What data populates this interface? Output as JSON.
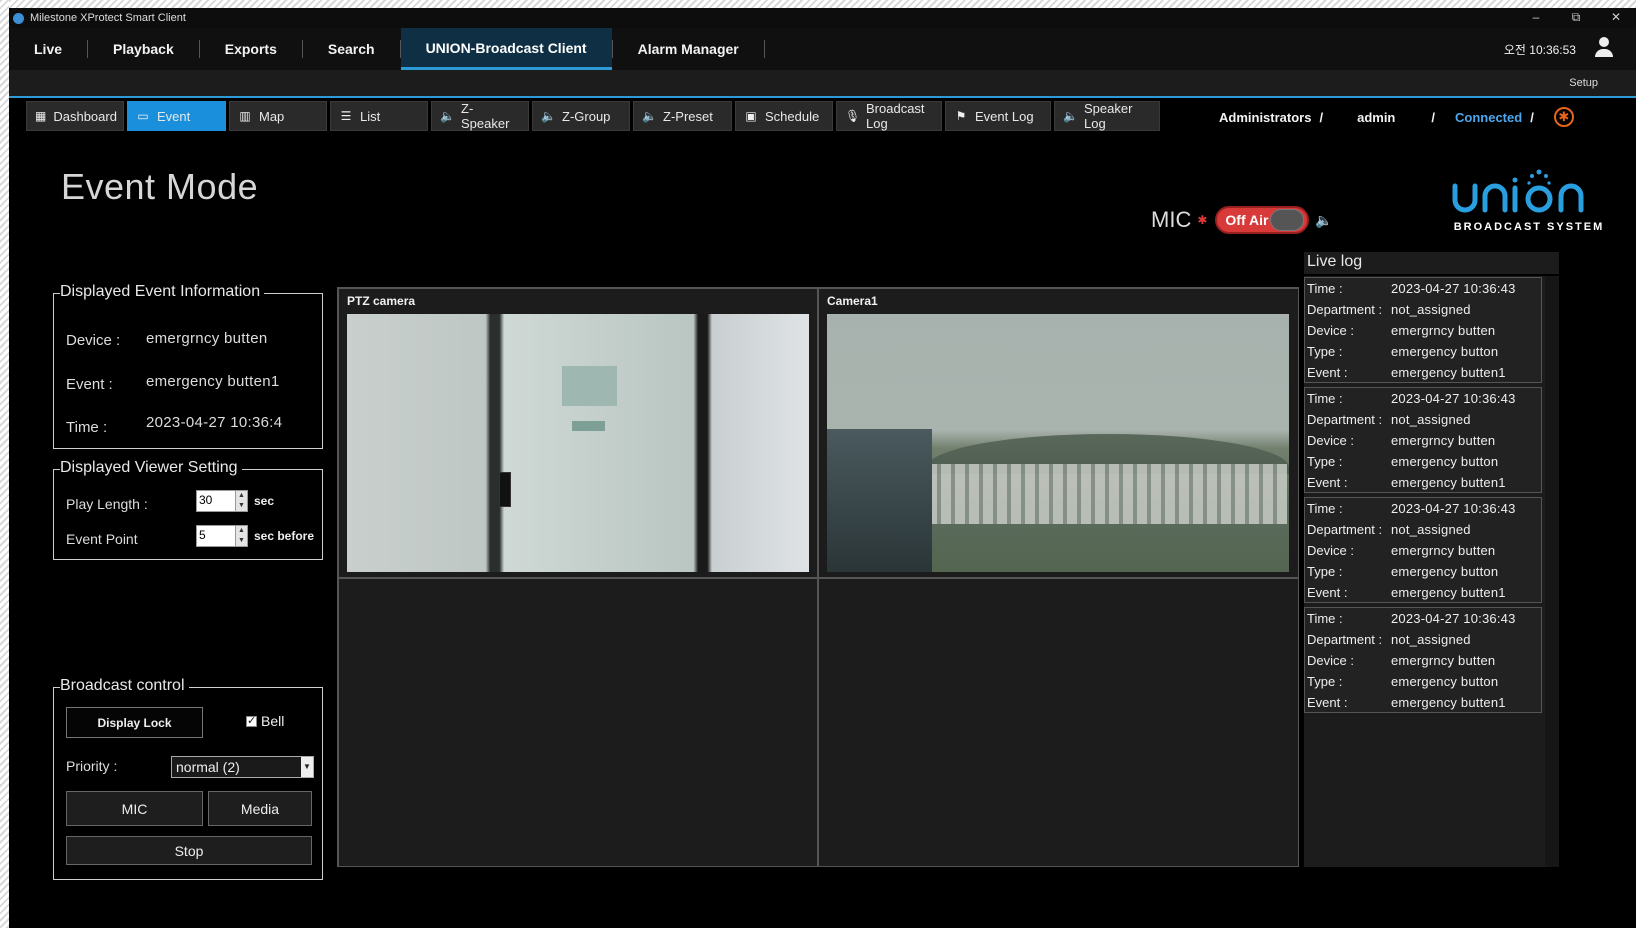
{
  "window": {
    "title": "Milestone XProtect Smart Client",
    "minimize": "–",
    "maximize": "⧉",
    "close": "✕"
  },
  "main_nav": {
    "tabs": [
      "Live",
      "Playback",
      "Exports",
      "Search",
      "UNION-Broadcast Client",
      "Alarm Manager"
    ],
    "active": "UNION-Broadcast Client",
    "clock": "오전 10:36:53",
    "setup": "Setup"
  },
  "sub_nav": {
    "tabs": [
      {
        "label": "Dashboard",
        "icon": "dashboard-icon",
        "glyph": "▦"
      },
      {
        "label": "Event",
        "icon": "event-icon",
        "glyph": "▭",
        "active": true
      },
      {
        "label": "Map",
        "icon": "map-icon",
        "glyph": "▥"
      },
      {
        "label": "List",
        "icon": "list-icon",
        "glyph": "☰"
      },
      {
        "label": "Z-Speaker",
        "icon": "speaker-icon",
        "glyph": "🔈"
      },
      {
        "label": "Z-Group",
        "icon": "speaker-group-icon",
        "glyph": "🔈"
      },
      {
        "label": "Z-Preset",
        "icon": "preset-icon",
        "glyph": "🔈"
      },
      {
        "label": "Schedule",
        "icon": "calendar-icon",
        "glyph": "▣"
      },
      {
        "label": "Broadcast Log",
        "icon": "broadcast-log-icon",
        "glyph": "🎙"
      },
      {
        "label": "Event Log",
        "icon": "event-log-icon",
        "glyph": "⚑"
      },
      {
        "label": "Speaker Log",
        "icon": "speaker-log-icon",
        "glyph": "🔈"
      }
    ],
    "status": {
      "group": "Administrators",
      "user": "admin",
      "connection": "Connected",
      "sep": "/",
      "accent": "#4ea6ee"
    }
  },
  "page": {
    "title": "Event Mode"
  },
  "mic": {
    "label": "MIC",
    "state_label": "Off Air",
    "on_air": false,
    "toggle_color": "#d83a3a"
  },
  "logo": {
    "text": "union",
    "subtitle": "BROADCAST SYSTEM"
  },
  "event_info": {
    "legend": "Displayed Event Information",
    "device_label": "Device :",
    "device": "emergrncy butten",
    "event_label": "Event :",
    "event": "emergency butten1",
    "time_label": "Time :",
    "time": "2023-04-27 10:36:4"
  },
  "viewer_setting": {
    "legend": "Displayed Viewer Setting",
    "play_length_label": "Play Length :",
    "play_length": "30",
    "play_length_unit": "sec",
    "event_point_label": "Event Point",
    "event_point": "5",
    "event_point_unit": "sec before"
  },
  "broadcast_control": {
    "legend": "Broadcast control",
    "display_lock": "Display Lock",
    "bell_label": "Bell",
    "bell_checked": true,
    "priority_label": "Priority :",
    "priority": "normal (2)",
    "mic_button": "MIC",
    "media_button": "Media",
    "stop_button": "Stop"
  },
  "cameras": [
    {
      "title": "PTZ camera"
    },
    {
      "title": "Camera1"
    }
  ],
  "live_log": {
    "title": "Live log",
    "labels": {
      "time": "Time :",
      "department": "Department :",
      "device": "Device :",
      "type": "Type :",
      "event": "Event :"
    },
    "entries": [
      {
        "time": "2023-04-27 10:36:43",
        "department": "not_assigned",
        "device": "emergrncy butten",
        "type": "emergency button",
        "event": "emergency butten1"
      },
      {
        "time": "2023-04-27 10:36:43",
        "department": "not_assigned",
        "device": "emergrncy butten",
        "type": "emergency button",
        "event": "emergency butten1"
      },
      {
        "time": "2023-04-27 10:36:43",
        "department": "not_assigned",
        "device": "emergrncy butten",
        "type": "emergency button",
        "event": "emergency butten1"
      },
      {
        "time": "2023-04-27 10:36:43",
        "department": "not_assigned",
        "device": "emergrncy butten",
        "type": "emergency button",
        "event": "emergency butten1"
      }
    ]
  }
}
